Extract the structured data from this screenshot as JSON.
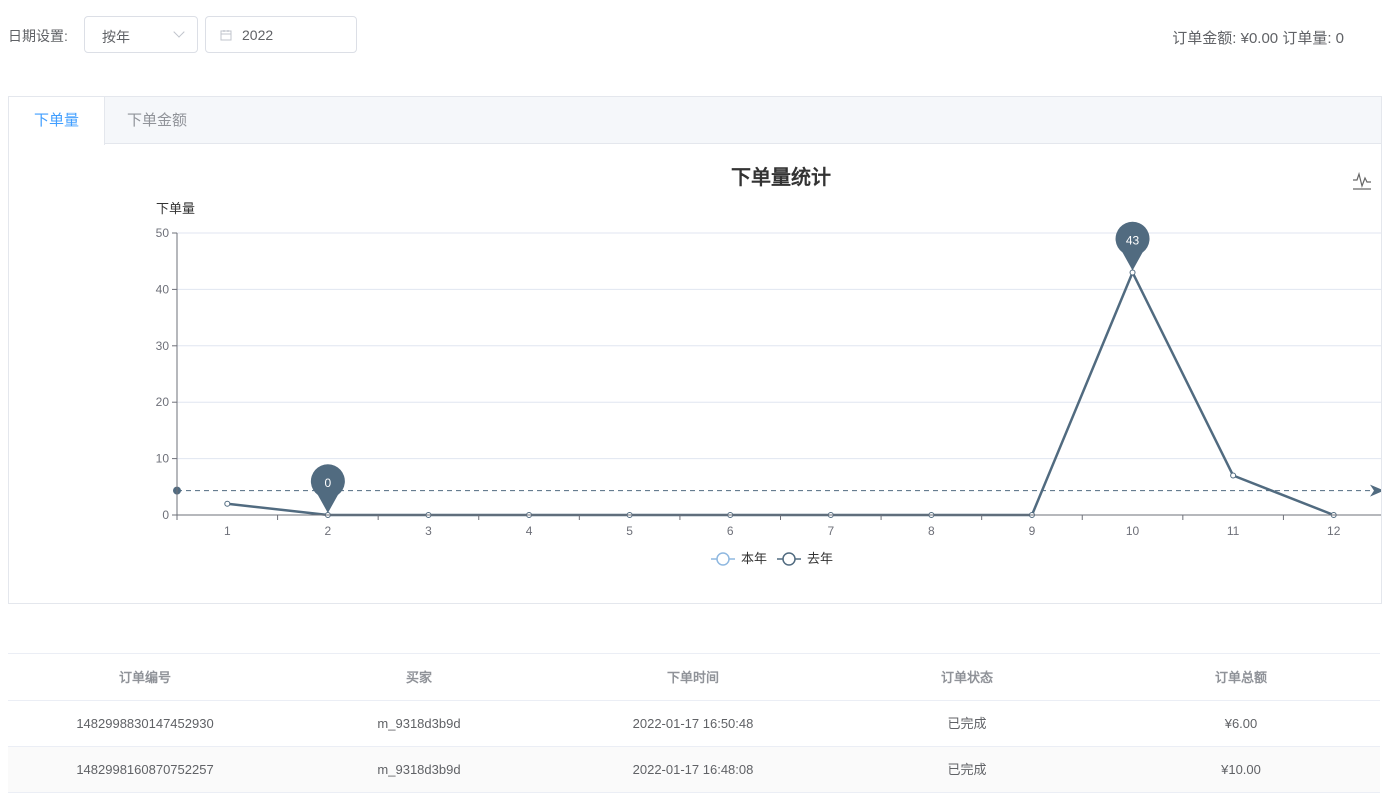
{
  "filters": {
    "date_label": "日期设置:",
    "period_select": "按年",
    "year_value": "2022",
    "summary_text": "订单金额: ¥0.00 订单量: 0"
  },
  "tabs": [
    {
      "label": "下单量",
      "active": true
    },
    {
      "label": "下单金额",
      "active": false
    }
  ],
  "chart_toolbox": {
    "icon": "line-chart-icon"
  },
  "colors": {
    "accent": "#409eff",
    "series": "#516b80",
    "grid": "#e0e6f1"
  },
  "chart_data": {
    "type": "line",
    "title": "下单量统计",
    "ylabel": "下单量",
    "xlabel": "",
    "categories": [
      "1",
      "2",
      "3",
      "4",
      "5",
      "6",
      "7",
      "8",
      "9",
      "10",
      "11",
      "12"
    ],
    "ylim": [
      0,
      50
    ],
    "yticks": [
      0,
      10,
      20,
      30,
      40,
      50
    ],
    "series": [
      {
        "name": "本年",
        "values": [
          2,
          0,
          0,
          0,
          0,
          0,
          0,
          0,
          0,
          43,
          7,
          0
        ]
      },
      {
        "name": "去年",
        "values": []
      }
    ],
    "mark_points": [
      {
        "label": "43",
        "category": "10",
        "value": 43
      },
      {
        "label": "0",
        "category": "2",
        "value": 0
      }
    ],
    "mark_line": {
      "type": "average",
      "value": 4.33
    },
    "legend": [
      "本年",
      "去年"
    ],
    "legend_position": "bottom",
    "grid": true
  },
  "orders_table": {
    "headers": [
      "订单编号",
      "买家",
      "下单时间",
      "订单状态",
      "订单总额"
    ],
    "rows": [
      [
        "1482998830147452930",
        "m_9318d3b9d",
        "2022-01-17 16:50:48",
        "已完成",
        "¥6.00"
      ],
      [
        "1482998160870752257",
        "m_9318d3b9d",
        "2022-01-17 16:48:08",
        "已完成",
        "¥10.00"
      ]
    ]
  }
}
